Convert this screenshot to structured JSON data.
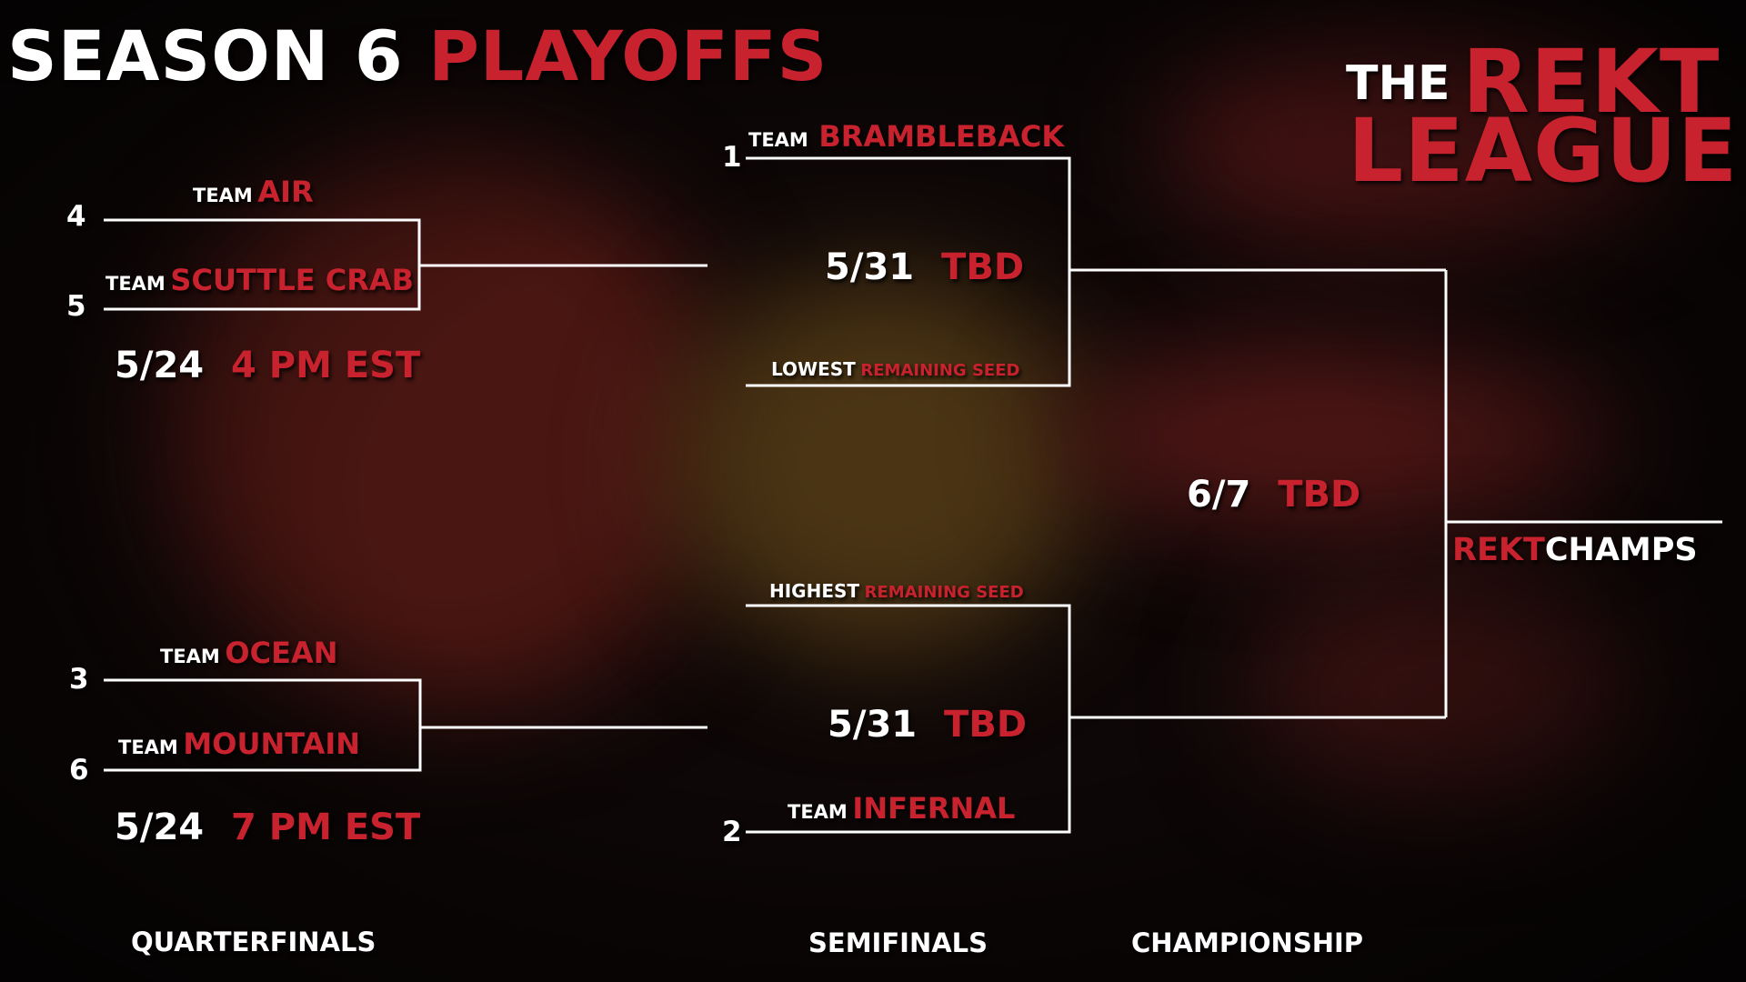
{
  "title": {
    "prefix": "SEASON 6",
    "accent": "PLAYOFFS"
  },
  "logo": {
    "the": "THE",
    "rekt": "REKT",
    "league": "LEAGUE"
  },
  "team_prefix": "TEAM",
  "quarterfinals": [
    {
      "top": {
        "seed": "4",
        "name": "AIR"
      },
      "bottom": {
        "seed": "5",
        "name": "SCUTTLE CRAB"
      },
      "date": "5/24",
      "time": "4 PM EST"
    },
    {
      "top": {
        "seed": "3",
        "name": "OCEAN"
      },
      "bottom": {
        "seed": "6",
        "name": "MOUNTAIN"
      },
      "date": "5/24",
      "time": "7 PM EST"
    }
  ],
  "semifinals": [
    {
      "top": {
        "seed": "1",
        "name": "BRAMBLEBACK"
      },
      "bottom": {
        "prefix": "LOWEST",
        "label": "REMAINING SEED"
      },
      "date": "5/31",
      "time": "TBD"
    },
    {
      "top": {
        "prefix": "HIGHEST",
        "label": "REMAINING SEED"
      },
      "bottom": {
        "seed": "2",
        "name": "INFERNAL"
      },
      "date": "5/31",
      "time": "TBD"
    }
  ],
  "championship": {
    "date": "6/7",
    "time": "TBD"
  },
  "champion": {
    "accent": "REKT",
    "label": "CHAMPS"
  },
  "rounds": {
    "quarterfinals": "QUARTERFINALS",
    "semifinals": "SEMIFINALS",
    "championship": "CHAMPIONSHIP"
  },
  "colors": {
    "accent": "#c8222e",
    "text": "#ffffff",
    "background": "#0e0707"
  }
}
